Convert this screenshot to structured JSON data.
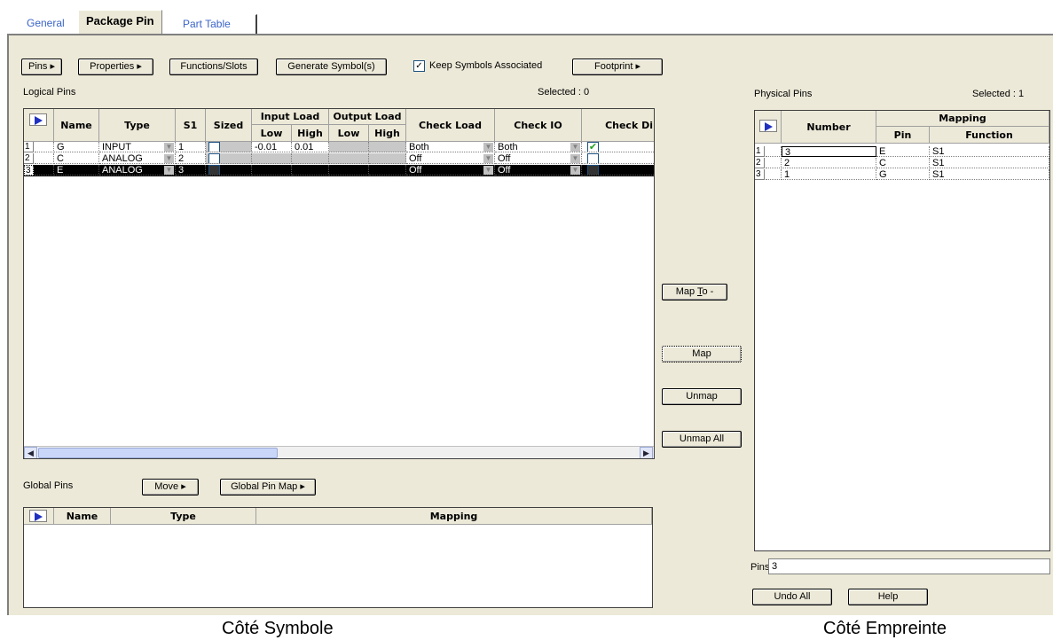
{
  "tabs": [
    "General",
    "Package Pin",
    "Part Table"
  ],
  "toolbar": {
    "pins": "Pins",
    "properties": "Properties",
    "functions_slots": "Functions/Slots",
    "generate_symbols": "Generate Symbol(s)",
    "keep_symbols": "Keep Symbols Associated",
    "footprint": "Footprint"
  },
  "logical": {
    "title": "Logical Pins",
    "selected": "Selected : 0",
    "headers": {
      "name": "Name",
      "type": "Type",
      "s1": "S1",
      "sized": "Sized",
      "input_load": "Input Load",
      "output_load": "Output Load",
      "low": "Low",
      "high": "High",
      "check_load": "Check Load",
      "check_io": "Check IO",
      "check_di": "Check Di"
    },
    "rows": [
      {
        "num": "1",
        "name": "G",
        "type": "INPUT",
        "s1": "1",
        "in_low": "-0.01",
        "in_high": "0.01",
        "check_load": "Both",
        "check_io": "Both",
        "checked": true
      },
      {
        "num": "2",
        "name": "C",
        "type": "ANALOG",
        "s1": "2",
        "in_low": "",
        "in_high": "",
        "check_load": "Off",
        "check_io": "Off",
        "checked": false
      },
      {
        "num": "3",
        "name": "E",
        "type": "ANALOG",
        "s1": "3",
        "in_low": "",
        "in_high": "",
        "check_load": "Off",
        "check_io": "Off",
        "checked": false
      }
    ]
  },
  "global": {
    "title": "Global Pins",
    "move": "Move",
    "global_pin_map": "Global Pin Map",
    "headers": {
      "name": "Name",
      "type": "Type",
      "mapping": "Mapping"
    }
  },
  "map_buttons": {
    "map_to": "Map To -",
    "map": "Map",
    "unmap": "Unmap",
    "unmap_all": "Unmap All"
  },
  "physical": {
    "title": "Physical Pins",
    "selected": "Selected : 1",
    "headers": {
      "number": "Number",
      "mapping": "Mapping",
      "pin": "Pin",
      "function": "Function"
    },
    "rows": [
      {
        "num": "1",
        "number": "3",
        "pin": "E",
        "function": "S1"
      },
      {
        "num": "2",
        "number": "2",
        "pin": "C",
        "function": "S1"
      },
      {
        "num": "3",
        "number": "1",
        "pin": "G",
        "function": "S1"
      }
    ],
    "pins_label": "Pins",
    "pins_value": "3",
    "undo_all": "Undo All",
    "help": "Help"
  },
  "captions": {
    "left": "Côté Symbole",
    "right": "Côté Empreinte"
  },
  "colors": {
    "panel": "#ece9d8",
    "tab_link": "#3a64c8",
    "selection": "#000000",
    "arrow": "#2030c0"
  }
}
